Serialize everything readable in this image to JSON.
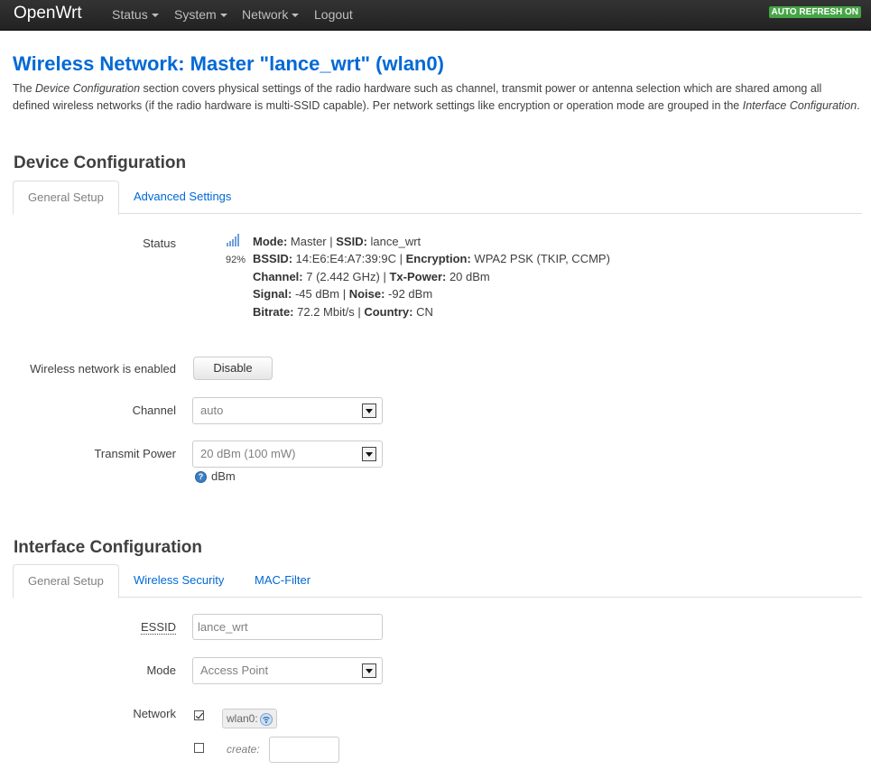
{
  "header": {
    "brand": "OpenWrt",
    "nav": [
      {
        "label": "Status",
        "dropdown": true
      },
      {
        "label": "System",
        "dropdown": true
      },
      {
        "label": "Network",
        "dropdown": true
      },
      {
        "label": "Logout",
        "dropdown": false
      }
    ],
    "refresh_badge": "AUTO REFRESH ON",
    "badge_color": "#46a546"
  },
  "page": {
    "title": "Wireless Network: Master \"lance_wrt\" (wlan0)",
    "intro": {
      "p1": "The ",
      "em1": "Device Configuration",
      "p2": " section covers physical settings of the radio hardware such as channel, transmit power or antenna selection which are shared among all defined wireless networks (if the radio hardware is multi-SSID capable). Per network settings like encryption or operation mode are grouped in the ",
      "em2": "Interface Configuration",
      "p3": "."
    }
  },
  "device": {
    "title": "Device Configuration",
    "tabs": [
      "General Setup",
      "Advanced Settings"
    ],
    "status": {
      "label": "Status",
      "signal_percent": "92%",
      "lines": [
        [
          {
            "k": "Mode:",
            "v": " Master | "
          },
          {
            "k": "SSID:",
            "v": " lance_wrt"
          }
        ],
        [
          {
            "k": "BSSID:",
            "v": " 14:E6:E4:A7:39:9C | "
          },
          {
            "k": "Encryption:",
            "v": " WPA2 PSK (TKIP, CCMP)"
          }
        ],
        [
          {
            "k": "Channel:",
            "v": " 7 (2.442 GHz) | "
          },
          {
            "k": "Tx-Power:",
            "v": " 20 dBm"
          }
        ],
        [
          {
            "k": "Signal:",
            "v": " -45 dBm | "
          },
          {
            "k": "Noise:",
            "v": " -92 dBm"
          }
        ],
        [
          {
            "k": "Bitrate:",
            "v": " 72.2 Mbit/s | "
          },
          {
            "k": "Country:",
            "v": " CN"
          }
        ]
      ]
    },
    "enabled_label": "Wireless network is enabled",
    "disable_button": "Disable",
    "channel_label": "Channel",
    "channel_value": "auto",
    "txpower_label": "Transmit Power",
    "txpower_value": "20 dBm (100 mW)",
    "txpower_help": "dBm"
  },
  "iface": {
    "title": "Interface Configuration",
    "tabs": [
      "General Setup",
      "Wireless Security",
      "MAC-Filter"
    ],
    "essid_label": "ESSID",
    "essid_value": "lance_wrt",
    "mode_label": "Mode",
    "mode_value": "Access Point",
    "network_label": "Network",
    "network_checked": true,
    "network_name": "wlan0:",
    "create_label": "create:"
  },
  "colors": {
    "link": "#0069d6",
    "text": "#404040"
  }
}
